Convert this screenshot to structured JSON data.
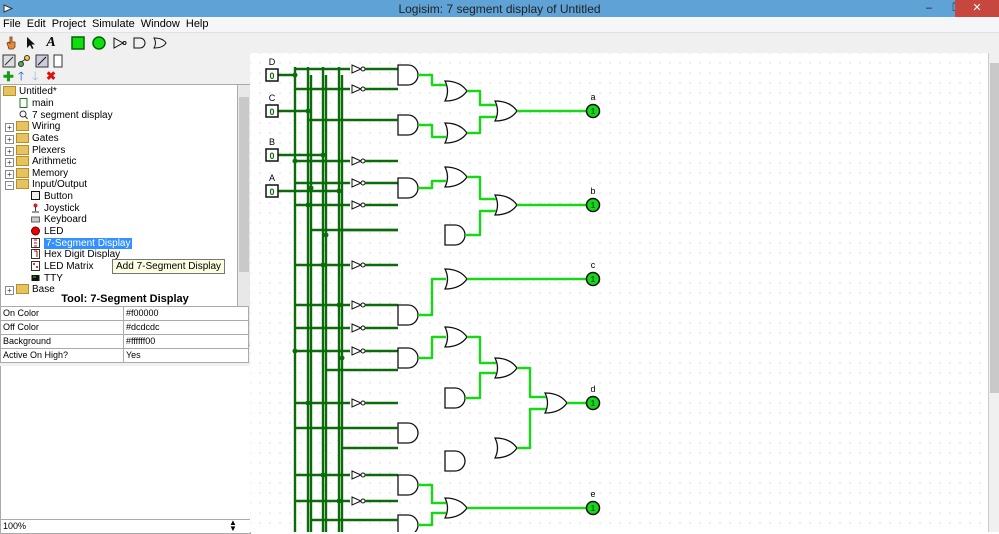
{
  "window": {
    "title": "Logisim: 7 segment display of Untitled",
    "minimize": "–",
    "restore": "❐",
    "close": "✕"
  },
  "menu": [
    "File",
    "Edit",
    "Project",
    "Simulate",
    "Window",
    "Help"
  ],
  "toolbar": {
    "text_tool": "A"
  },
  "tree": {
    "root": "Untitled*",
    "items": [
      {
        "label": "main"
      },
      {
        "label": "7 segment display"
      },
      {
        "label": "Wiring"
      },
      {
        "label": "Gates"
      },
      {
        "label": "Plexers"
      },
      {
        "label": "Arithmetic"
      },
      {
        "label": "Memory"
      },
      {
        "label": "Input/Output"
      },
      {
        "label": "Button"
      },
      {
        "label": "Joystick"
      },
      {
        "label": "Keyboard"
      },
      {
        "label": "LED"
      },
      {
        "label": "7-Segment Display"
      },
      {
        "label": "Hex Digit Display"
      },
      {
        "label": "LED Matrix"
      },
      {
        "label": "TTY"
      },
      {
        "label": "Base"
      }
    ],
    "tooltip": "Add 7-Segment Display"
  },
  "attributes": {
    "header": "Tool: 7-Segment Display",
    "rows": [
      {
        "name": "On Color",
        "value": "#f00000"
      },
      {
        "name": "Off Color",
        "value": "#dcdcdc"
      },
      {
        "name": "Background",
        "value": "#ffffff00"
      },
      {
        "name": "Active On High?",
        "value": "Yes"
      }
    ]
  },
  "zoom": "100%",
  "circuit": {
    "inputs": [
      {
        "label": "D",
        "value": "0"
      },
      {
        "label": "C",
        "value": "0"
      },
      {
        "label": "B",
        "value": "0"
      },
      {
        "label": "A",
        "value": "0"
      }
    ],
    "outputs": [
      {
        "label": "a"
      },
      {
        "label": "b"
      },
      {
        "label": "c"
      },
      {
        "label": "d"
      },
      {
        "label": "e"
      }
    ],
    "colors": {
      "wire_low": "#0b6b0b",
      "wire_high": "#19d619",
      "accent": "#3390ff"
    }
  }
}
